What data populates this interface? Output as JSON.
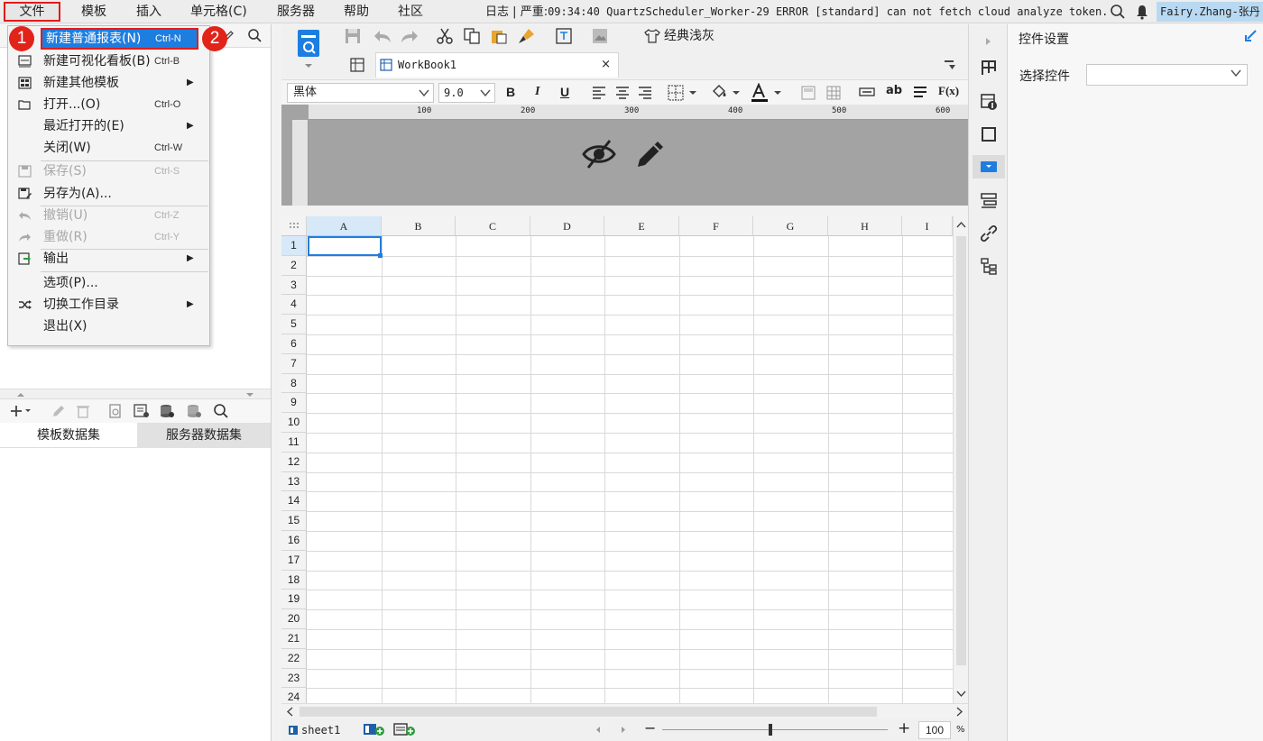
{
  "menubar": {
    "items": [
      {
        "label": "文件",
        "left": 0
      },
      {
        "label": "模板"
      },
      {
        "label": "插入"
      },
      {
        "label": "单元格(C)"
      },
      {
        "label": "服务器"
      },
      {
        "label": "帮助"
      },
      {
        "label": "社区"
      }
    ],
    "log_label": "日志",
    "log_sep": "|",
    "log_level": "严重:",
    "log_message": "09:34:40 QuartzScheduler_Worker-29 ERROR [standard] can not fetch cloud analyze token.",
    "user": "Fairy.Zhang-张丹"
  },
  "file_menu": {
    "items": [
      {
        "label": "新建普通报表(N)",
        "shortcut": "Ctrl-N"
      },
      {
        "label": "新建可视化看板(B)",
        "shortcut": "Ctrl-B"
      },
      {
        "label": "新建其他模板",
        "arrow": "▶"
      },
      {
        "label": "打开...(O)",
        "shortcut": "Ctrl-O"
      },
      {
        "label": "最近打开的(E)",
        "arrow": "▶"
      },
      {
        "label": "关闭(W)",
        "shortcut": "Ctrl-W"
      },
      {
        "label": "保存(S)",
        "shortcut": "Ctrl-S"
      },
      {
        "label": "另存为(A)..."
      },
      {
        "label": "撤销(U)",
        "shortcut": "Ctrl-Z"
      },
      {
        "label": "重做(R)",
        "shortcut": "Ctrl-Y"
      },
      {
        "label": "输出",
        "arrow": "▶"
      },
      {
        "label": "选项(P)..."
      },
      {
        "label": "切换工作目录",
        "arrow": "▶"
      },
      {
        "label": "退出(X)"
      }
    ],
    "badge1": "1",
    "badge2": "2"
  },
  "datasets": {
    "tab_template": "模板数据集",
    "tab_server": "服务器数据集"
  },
  "toolbar": {
    "theme_label": "经典浅灰",
    "workbook_tab": "WorkBook1",
    "close_glyph": "×",
    "font_name": "黑体",
    "font_size": "9.0",
    "bold": "B",
    "italic": "I",
    "underline": "U",
    "text_ab": "ab",
    "formula": "F(x)"
  },
  "ruler": {
    "ticks": [
      "100",
      "200",
      "300",
      "400",
      "500",
      "600"
    ]
  },
  "grid": {
    "columns": [
      "A",
      "B",
      "C",
      "D",
      "E",
      "F",
      "G",
      "H",
      "I"
    ],
    "rows": [
      "1",
      "2",
      "3",
      "4",
      "5",
      "6",
      "7",
      "8",
      "9",
      "10",
      "11",
      "12",
      "13",
      "14",
      "15",
      "16",
      "17",
      "18",
      "19",
      "20",
      "21",
      "22",
      "23",
      "24"
    ]
  },
  "status": {
    "sheet_name": "sheet1",
    "zoom_minus": "−",
    "zoom_plus": "+",
    "zoom_value": "100",
    "zoom_unit": "%"
  },
  "right_panel": {
    "title": "控件设置",
    "select_label": "选择控件",
    "select_value": ""
  },
  "colors": {
    "accent": "#1e7ee0",
    "highlight_border": "#e21b1b",
    "badge": "#e2231a"
  }
}
